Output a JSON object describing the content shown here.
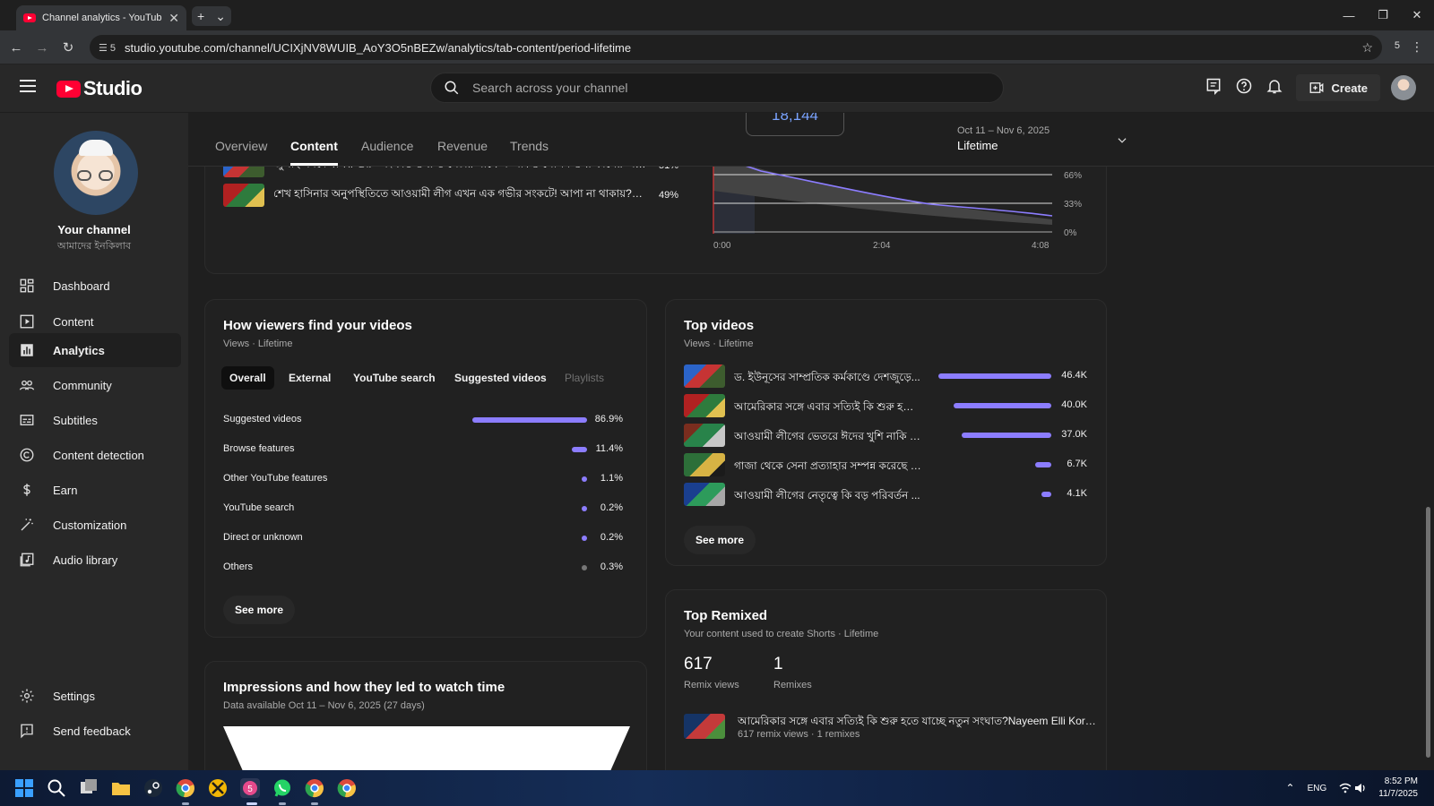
{
  "browser": {
    "tab_title": "Channel analytics - YouTube Studio",
    "tab_close": "✕",
    "new_tab": "+",
    "tab_menu": "⌄",
    "url_site_count": "5",
    "url": "studio.youtube.com/channel/UCIXjNV8WUIB_AoY3O5nBEZw/analytics/tab-content/period-lifetime",
    "extension_badge": "5"
  },
  "header": {
    "logo_text": "Studio",
    "search_placeholder": "Search across your channel",
    "create_label": "Create"
  },
  "sidebar": {
    "channel_title": "Your channel",
    "channel_name": "আমাদের ইনকিলাব",
    "items": [
      {
        "label": "Dashboard",
        "icon": "dashboard-icon"
      },
      {
        "label": "Content",
        "icon": "content-icon"
      },
      {
        "label": "Analytics",
        "icon": "analytics-icon",
        "active": true
      },
      {
        "label": "Community",
        "icon": "community-icon"
      },
      {
        "label": "Subtitles",
        "icon": "subtitles-icon"
      },
      {
        "label": "Content detection",
        "icon": "copyright-icon"
      },
      {
        "label": "Earn",
        "icon": "dollar-icon"
      },
      {
        "label": "Customization",
        "icon": "magic-wand-icon"
      },
      {
        "label": "Audio library",
        "icon": "audio-library-icon"
      }
    ],
    "footer": [
      {
        "label": "Settings",
        "icon": "gear-icon"
      },
      {
        "label": "Send feedback",
        "icon": "feedback-icon"
      }
    ]
  },
  "tabs": [
    "Overview",
    "Content",
    "Audience",
    "Revenue",
    "Trends"
  ],
  "active_tab": "Content",
  "peek_value": "18,144",
  "date_range": {
    "range": "Oct 11 – Nov 6, 2025",
    "label": "Lifetime"
  },
  "retention": {
    "rows": [
      {
        "title": "জুলাই সনদে স্বাক্ষর শুরু\" সংক্রান্ত তথ্য ও সেটার সাথে সম্পর্কিত গোপন তথ্য ফাঁসের অভিযোগ...",
        "pct": "51%"
      },
      {
        "title": "শেখ হাসিনার অনুপস্থিতিতে আওয়ামী লীগ এখন এক গভীর সংকটে! আপা না থাকায়?Nayeem ...",
        "pct": "49%"
      }
    ],
    "y_ticks": [
      "66%",
      "33%",
      "0%"
    ],
    "x_ticks": [
      "0:00",
      "2:04",
      "4:08"
    ]
  },
  "traffic": {
    "title": "How viewers find your videos",
    "subtitle": "Views · Lifetime",
    "filters": [
      "Overall",
      "External",
      "YouTube search",
      "Suggested videos",
      "Playlists"
    ],
    "rows": [
      {
        "label": "Suggested videos",
        "value": 86.9,
        "pct": "86.9%"
      },
      {
        "label": "Browse features",
        "value": 11.4,
        "pct": "11.4%"
      },
      {
        "label": "Other YouTube features",
        "value": 1.1,
        "pct": "1.1%"
      },
      {
        "label": "YouTube search",
        "value": 0.2,
        "pct": "0.2%"
      },
      {
        "label": "Direct or unknown",
        "value": 0.2,
        "pct": "0.2%"
      },
      {
        "label": "Others",
        "value": 0.3,
        "pct": "0.3%"
      }
    ],
    "see_more": "See more"
  },
  "top_videos": {
    "title": "Top videos",
    "subtitle": "Views · Lifetime",
    "rows": [
      {
        "title": "ড. ইউনূসের সাম্প্রতিক কর্মকাণ্ডে দেশজুড়ে...",
        "views": 46400,
        "label": "46.4K"
      },
      {
        "title": "আমেরিকার সঙ্গে এবার সত্যিই কি শুরু হতে...",
        "views": 40000,
        "label": "40.0K"
      },
      {
        "title": "আওয়ামী লীগের ভেতরে ঈদের খুশি নাকি ন...",
        "views": 37000,
        "label": "37.0K"
      },
      {
        "title": "গাজা থেকে সেনা প্রত্যাহার সম্পন্ন করেছে ই...",
        "views": 6700,
        "label": "6.7K"
      },
      {
        "title": "আওয়ামী লীগের নেতৃত্বে কি বড় পরিবর্তন ...",
        "views": 4100,
        "label": "4.1K"
      }
    ],
    "see_more": "See more"
  },
  "impressions": {
    "title": "Impressions and how they led to watch time",
    "subtitle": "Data available Oct 11 – Nov 6, 2025 (27 days)"
  },
  "top_remixed": {
    "title": "Top Remixed",
    "subtitle": "Your content used to create Shorts · Lifetime",
    "remix_views": "617",
    "remix_views_label": "Remix views",
    "remixes": "1",
    "remixes_label": "Remixes",
    "video_title": "আমেরিকার সঙ্গে এবার সত্যিই কি শুরু হতে যাচ্ছে নতুন সংঘাত?Nayeem Elli Korea To...",
    "video_stats": "617 remix views · 1 remixes"
  },
  "taskbar": {
    "lang": "ENG",
    "time": "8:52 PM",
    "date": "11/7/2025"
  },
  "colors": {
    "accent_bar": "#8c7dff",
    "youtube_red": "#ff0033"
  }
}
